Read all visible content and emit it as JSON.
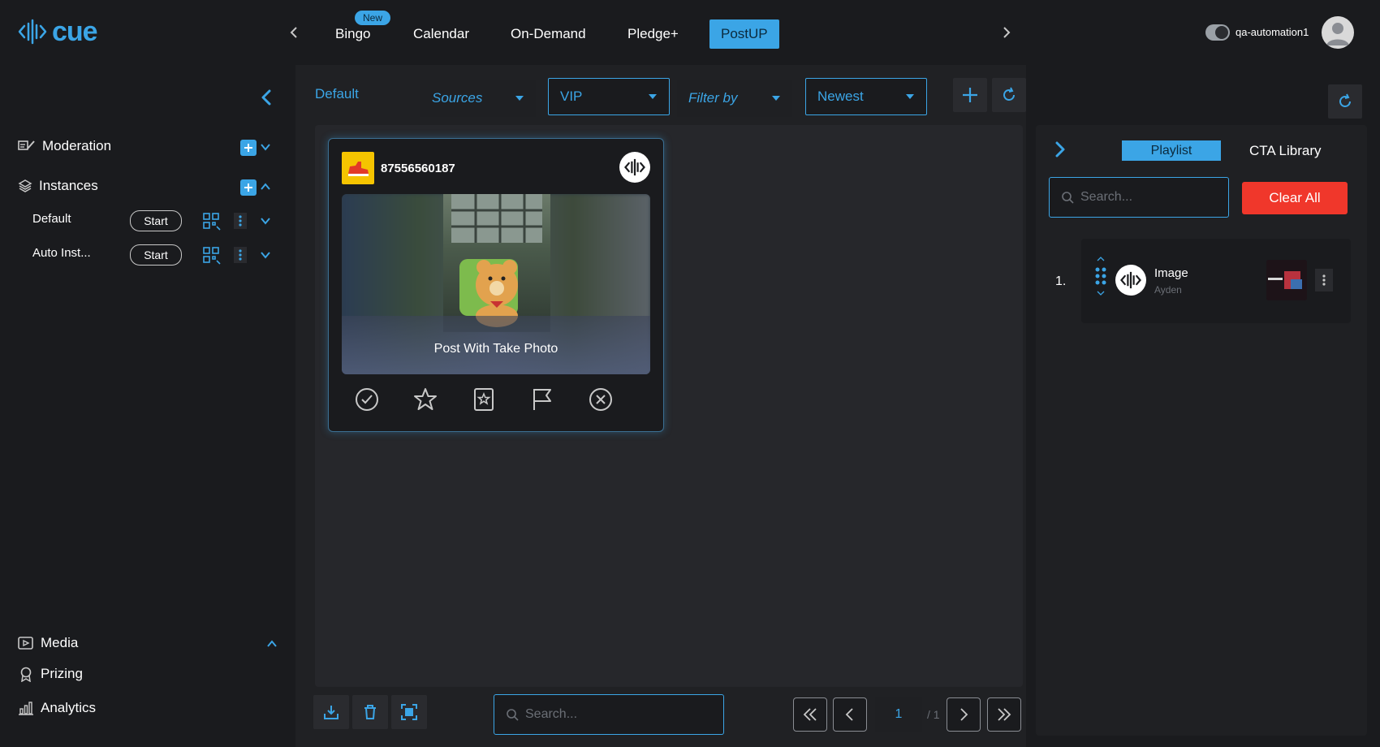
{
  "app": {
    "logo_text": "cue"
  },
  "topnav": {
    "tabs": [
      {
        "label": "Bingo",
        "badge": "New"
      },
      {
        "label": "Calendar"
      },
      {
        "label": "On-Demand"
      },
      {
        "label": "Pledge+"
      },
      {
        "label": "PostUP",
        "active": true
      }
    ],
    "username": "qa-automation1"
  },
  "sidebar": {
    "moderation_label": "Moderation",
    "instances_label": "Instances",
    "instances": [
      {
        "name": "Default",
        "start_label": "Start"
      },
      {
        "name": "Auto Inst...",
        "start_label": "Start"
      }
    ],
    "bottom": [
      {
        "label": "Media",
        "icon": "media-icon"
      },
      {
        "label": "Prizing",
        "icon": "prize-icon"
      },
      {
        "label": "Analytics",
        "icon": "analytics-icon"
      }
    ]
  },
  "toolbar": {
    "instance_label": "Default",
    "sources": "Sources",
    "vip": "VIP",
    "filter_by": "Filter by",
    "sort": "Newest"
  },
  "card": {
    "user_id": "87556560187",
    "caption": "Post With Take Photo"
  },
  "bottombar": {
    "search_placeholder": "Search...",
    "page_current": "1",
    "page_total": "/ 1"
  },
  "rightpanel": {
    "tab_playlist": "Playlist",
    "tab_cta": "CTA Library",
    "search_placeholder": "Search...",
    "clear_all": "Clear All",
    "items": [
      {
        "index": "1.",
        "title": "Image",
        "subtitle": "Ayden"
      }
    ]
  },
  "colors": {
    "accent": "#3ba5e6",
    "danger": "#f0372b",
    "background": "#1a1b1e"
  }
}
